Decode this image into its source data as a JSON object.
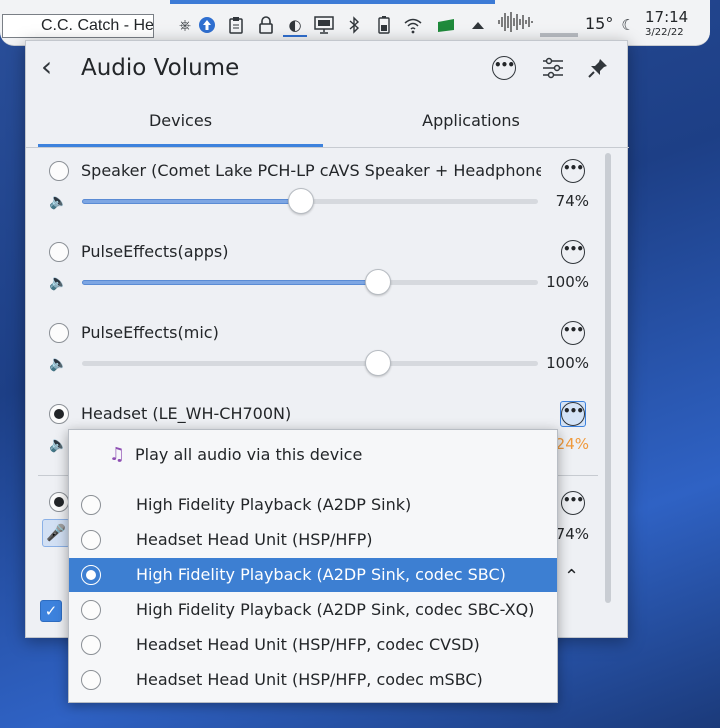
{
  "taskbar": {
    "window_title": "C.C. Catch - Heartbreak Hotel",
    "temperature": "15°",
    "time": "17:14",
    "date": "3/22/22",
    "tray_icons": [
      "kdeconnect-icon",
      "update-icon",
      "clipboard-icon",
      "lock-icon",
      "audio-icon",
      "display-icon",
      "bluetooth-icon",
      "battery-icon",
      "wifi-icon",
      "network-icon",
      "arrow-up-icon"
    ]
  },
  "popup": {
    "title": "Audio Volume",
    "tabs": [
      {
        "label": "Devices",
        "active": true
      },
      {
        "label": "Applications",
        "active": false
      }
    ],
    "devices": [
      {
        "name": "Speaker (Comet Lake PCH-LP cAVS Speaker + Headphones)",
        "selected": false,
        "volume": "74%",
        "level": 0.74
      },
      {
        "name": "PulseEffects(apps)",
        "selected": false,
        "volume": "100%",
        "level": 1.0
      },
      {
        "name": "PulseEffects(mic)",
        "selected": false,
        "volume": "100%",
        "level": 1.0
      },
      {
        "name": "Headset (LE_WH-CH700N)",
        "selected": true,
        "volume": "24%",
        "level": 0.24
      }
    ],
    "partial_volume": "74%"
  },
  "menu": {
    "header": "Play all audio via this device",
    "items": [
      {
        "label": "High Fidelity Playback (A2DP Sink)",
        "selected": false
      },
      {
        "label": "Headset Head Unit (HSP/HFP)",
        "selected": false
      },
      {
        "label": "High Fidelity Playback (A2DP Sink, codec SBC)",
        "selected": true
      },
      {
        "label": "High Fidelity Playback (A2DP Sink, codec SBC-XQ)",
        "selected": false
      },
      {
        "label": "Headset Head Unit (HSP/HFP, codec CVSD)",
        "selected": false
      },
      {
        "label": "Headset Head Unit (HSP/HFP, codec mSBC)",
        "selected": false
      }
    ]
  },
  "colors": {
    "accent": "#3d82dd",
    "warning_volume": "#f09a3c",
    "selection": "#3d7fd2"
  }
}
